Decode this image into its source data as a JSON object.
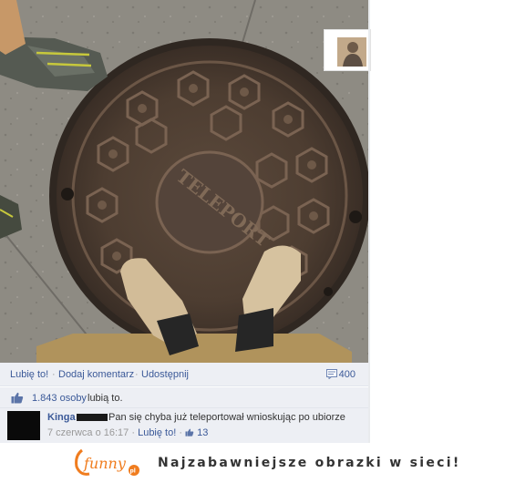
{
  "actions": {
    "like_label": "Lubię to!",
    "separator": "·",
    "comment_label": "Dodaj komentarz",
    "share_label": "Udostępnij",
    "comment_count": "400"
  },
  "likes": {
    "count": "1.843 osoby",
    "suffix": "lubią to."
  },
  "comment": {
    "author": "Kinga",
    "text": "Pan się chyba już teleportował wnioskując po ubiorze",
    "date": "7 czerwca o 16:17",
    "like_label": "Lubię to!",
    "like_count": "13"
  },
  "manhole": {
    "inscription": "TELEPORT"
  },
  "footer": {
    "logo_text": "funny",
    "logo_badge": "pl",
    "tagline": "Najzabawniejsze obrazki w sieci!"
  },
  "colors": {
    "link": "#3b5998",
    "panel": "#edeff4",
    "logo_orange": "#f07c1e"
  }
}
